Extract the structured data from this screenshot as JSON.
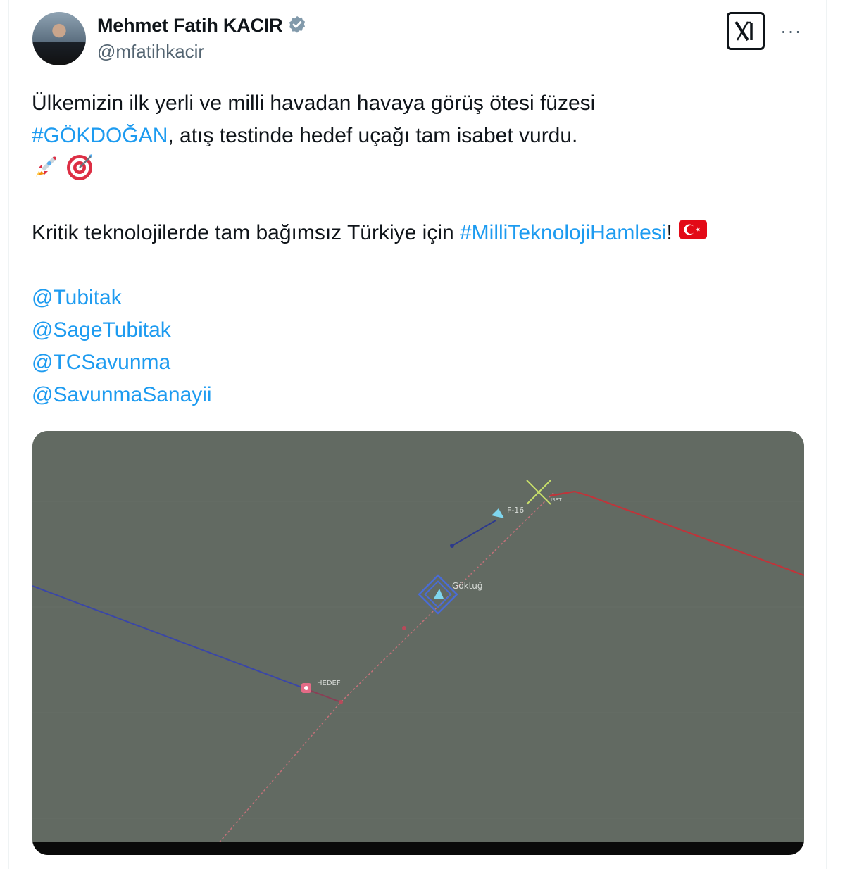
{
  "author": {
    "display_name": "Mehmet Fatih KACIR",
    "handle": "@mfatihkacir",
    "verified": true,
    "verified_icon": "verified-badge-icon"
  },
  "header_actions": {
    "x_logo_icon": "x-logo-icon",
    "more_icon": "more-options-icon",
    "more_label": "···"
  },
  "tweet": {
    "line1": "Ülkemizin ilk yerli ve milli havadan havaya görüş ötesi füzesi",
    "hashtag1": "#GÖKDOĞAN",
    "line2_rest": ", atış testinde hedef uçağı tam isabet vurdu.",
    "emojis_line3": [
      "rocket-emoji",
      "target-emoji"
    ],
    "line4_text": "Kritik teknolojilerde tam bağımsız Türkiye için ",
    "hashtag2": "#MilliTeknolojiHamlesi",
    "line4_end": "!",
    "flag_emoji": "turkey-flag-emoji",
    "mentions": [
      "@Tubitak",
      "@SageTubitak",
      "@TCSavunma",
      "@SavunmaSanayii"
    ]
  },
  "media": {
    "labels": {
      "f16": "F-16",
      "goktug": "Göktuğ",
      "hedef": "HEDEF",
      "impact": "ISBT"
    },
    "colors": {
      "background": "#626a62",
      "blue_track": "#3a46a8",
      "red_track": "#c0343a",
      "cyan_marker": "#7fd6ee",
      "pink_marker": "#e36b86",
      "impact_x": "#c8e06a"
    }
  }
}
